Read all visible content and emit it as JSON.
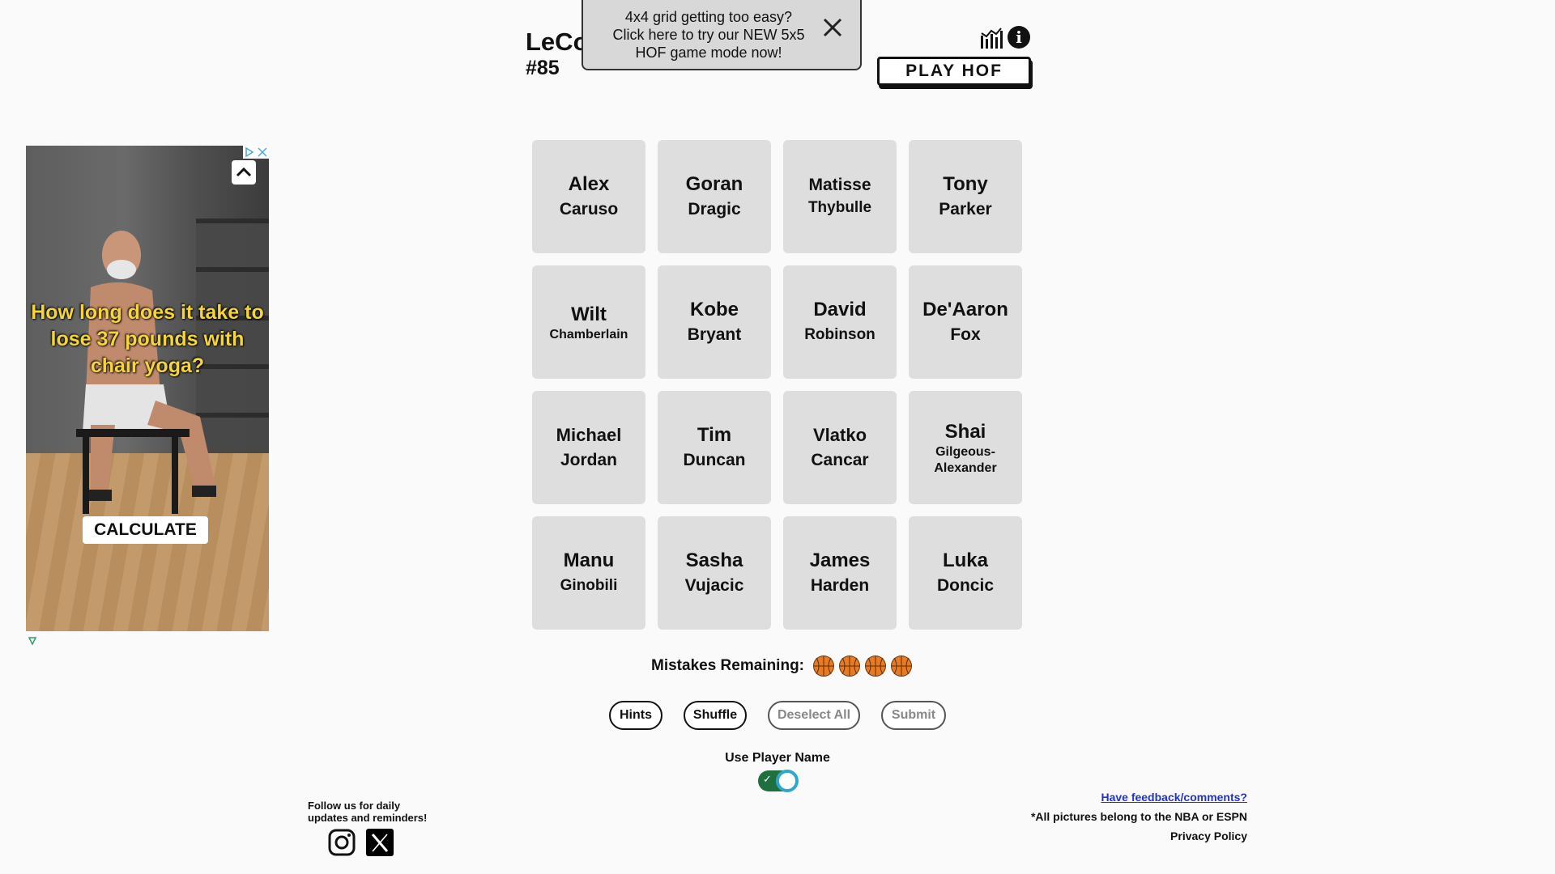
{
  "header": {
    "title": "LeCo",
    "puzzle_number": "#85",
    "play_hof_label": "PLAY HOF"
  },
  "banner": {
    "text": "4x4 grid getting too easy? Click here to try our NEW 5x5 HOF game mode now!"
  },
  "ad": {
    "headline": "How long does it take to lose 37 pounds with chair yoga?",
    "cta": "CALCULATE"
  },
  "grid": {
    "tiles": [
      {
        "first": "Alex",
        "last": "Caruso"
      },
      {
        "first": "Goran",
        "last": "Dragic"
      },
      {
        "first": "Matisse",
        "last": "Thybulle"
      },
      {
        "first": "Tony",
        "last": "Parker"
      },
      {
        "first": "Wilt",
        "last": "Chamberlain"
      },
      {
        "first": "Kobe",
        "last": "Bryant"
      },
      {
        "first": "David",
        "last": "Robinson"
      },
      {
        "first": "De'Aaron",
        "last": "Fox"
      },
      {
        "first": "Michael",
        "last": "Jordan"
      },
      {
        "first": "Tim",
        "last": "Duncan"
      },
      {
        "first": "Vlatko",
        "last": "Cancar"
      },
      {
        "first": "Shai",
        "last": "Gilgeous-Alexander"
      },
      {
        "first": "Manu",
        "last": "Ginobili"
      },
      {
        "first": "Sasha",
        "last": "Vujacic"
      },
      {
        "first": "James",
        "last": "Harden"
      },
      {
        "first": "Luka",
        "last": "Doncic"
      }
    ]
  },
  "mistakes": {
    "label": "Mistakes Remaining:",
    "remaining": 4,
    "ball_color": "#e87a23"
  },
  "controls": {
    "hints": "Hints",
    "shuffle": "Shuffle",
    "deselect_all": "Deselect All",
    "submit": "Submit"
  },
  "toggle": {
    "label": "Use Player Name",
    "on": true
  },
  "footer": {
    "follow_text": "Follow us for daily updates and reminders!",
    "feedback": "Have feedback/comments?",
    "credit": "*All pictures belong to the NBA or ESPN",
    "privacy": "Privacy Policy",
    "social_icons": [
      "instagram-icon",
      "x-icon"
    ]
  }
}
